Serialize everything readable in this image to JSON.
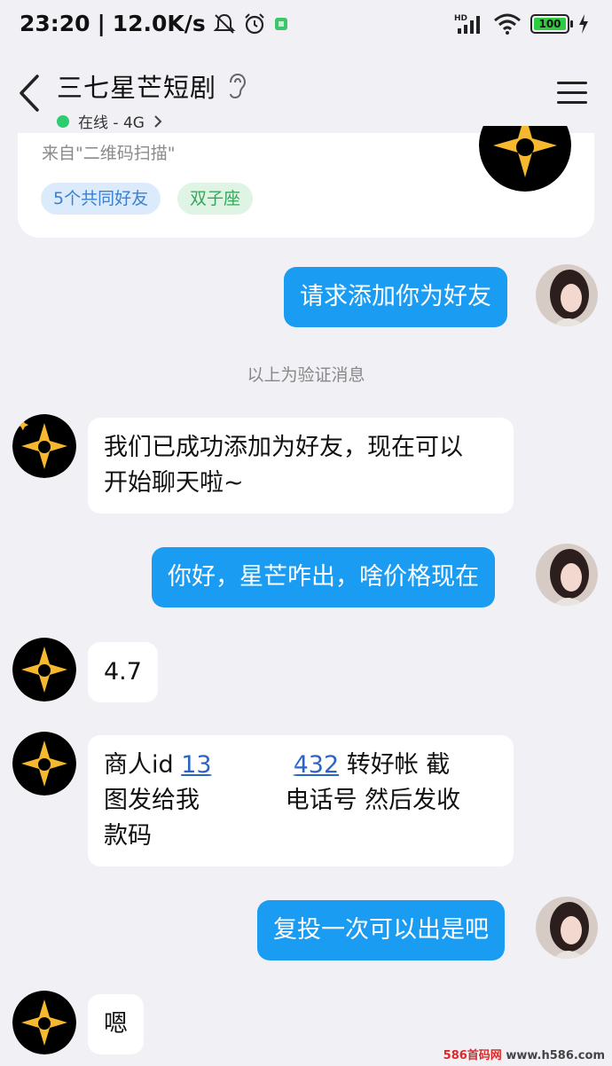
{
  "status_bar": {
    "time": "23:20",
    "speed": "12.0K/s",
    "battery": "100",
    "signal_label": "HD"
  },
  "header": {
    "title": "三七星芒短剧",
    "status": "在线 - 4G"
  },
  "profile_card": {
    "from": "来自\"二维码扫描\"",
    "tag_friends": "5个共同好友",
    "tag_zodiac": "双子座"
  },
  "messages": {
    "m1": "请求添加你为好友",
    "system": "以上为验证消息",
    "m2_line1": "我们已成功添加为好友，现在可以",
    "m2_line2": "开始聊天啦~",
    "m3": "你好，星芒咋出，啥价格现在",
    "m4": "4.7",
    "m5_part1": "商人id ",
    "m5_link1": "13",
    "m5_link2": "432",
    "m5_part2": " 转好帐  截",
    "m5_line2a": "图发给我 ",
    "m5_line2b": "电话号 然后发收",
    "m5_line3": "款码",
    "m6": "复投一次可以出是吧",
    "m7": "嗯"
  },
  "watermark": {
    "prefix": "586",
    "middle": "首码网",
    "suffix": " www.h586.com"
  },
  "colors": {
    "outgoing_bubble": "#1a9cf2",
    "online": "#2ecc71"
  }
}
